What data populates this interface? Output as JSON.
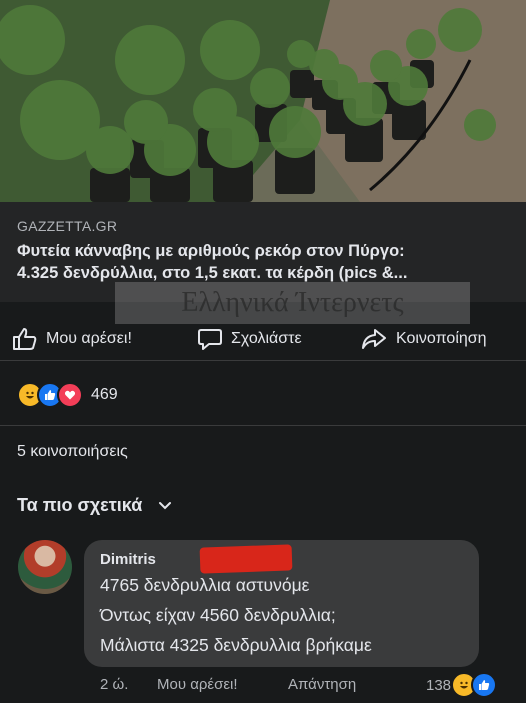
{
  "link_preview": {
    "domain": "GAZZETTA.GR",
    "headline_line1": "Φυτεία κάνναβης με αριθμούς ρεκόρ στον Πύργο:",
    "headline_line2": "4.325 δενδρύλλια, στο 1,5 εκατ. τα κέρδη (pics &...",
    "watermark": "Ελληνικά Ίντερνετς"
  },
  "actions": {
    "like": "Μου αρέσει!",
    "comment": "Σχολιάστε",
    "share": "Κοινοποίηση"
  },
  "reactions": {
    "count": "469",
    "icons": [
      "haha-icon",
      "like-icon",
      "love-icon"
    ]
  },
  "shares": "5 κοινοποιήσεις",
  "sort": {
    "label": "Τα πιο σχετικά"
  },
  "comment": {
    "author": "Dimitris",
    "lines": [
      "4765 δενδρυλλια αστυνόμε",
      "Όντως είχαν 4560 δενδρυλλια;",
      "Μάλιστα 4325 δενδρυλλια βρήκαμε"
    ],
    "time": "2 ώ.",
    "like": "Μου αρέσει!",
    "reply": "Απάντηση",
    "reaction_count": "138",
    "reaction_icons": [
      "haha-icon",
      "like-icon"
    ]
  },
  "colors": {
    "background": "#181a1b",
    "card": "#242526",
    "bubble": "#3a3b3c",
    "like_blue": "#1877f2",
    "love_red": "#f33e58",
    "haha_yellow": "#f7b928"
  }
}
